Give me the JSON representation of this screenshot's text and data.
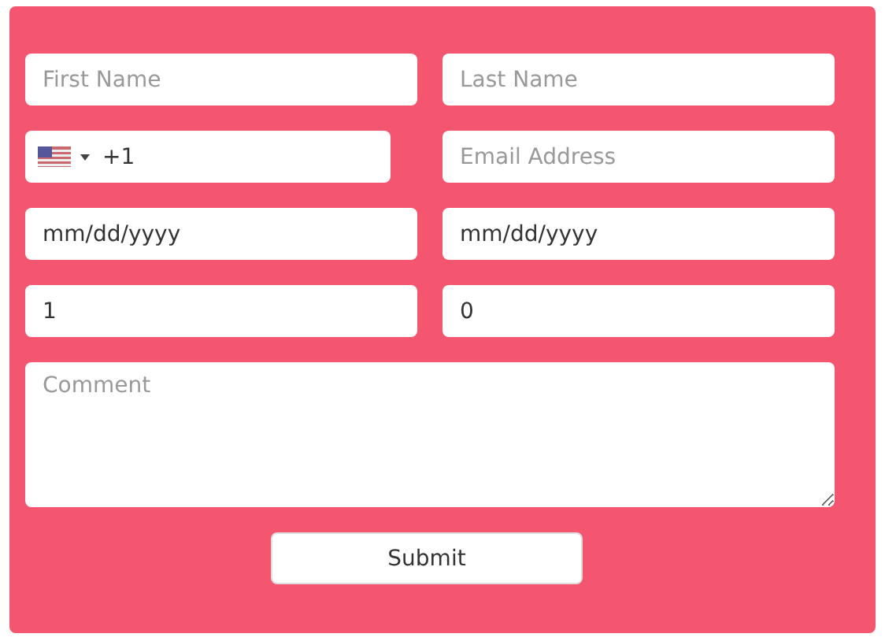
{
  "fields": [
    {
      "kind": "text",
      "placeholder": "First Name"
    },
    {
      "kind": "text",
      "placeholder": "Last Name"
    },
    {
      "kind": "phone",
      "value": "+1"
    },
    {
      "kind": "text",
      "placeholder": "Email Address"
    },
    {
      "kind": "text",
      "value": "mm/dd/yyyy"
    },
    {
      "kind": "text",
      "value": "mm/dd/yyyy"
    },
    {
      "kind": "text",
      "value": "1"
    },
    {
      "kind": "text",
      "value": "0"
    }
  ],
  "comment": {
    "placeholder": "Comment"
  },
  "submit": "Submit"
}
